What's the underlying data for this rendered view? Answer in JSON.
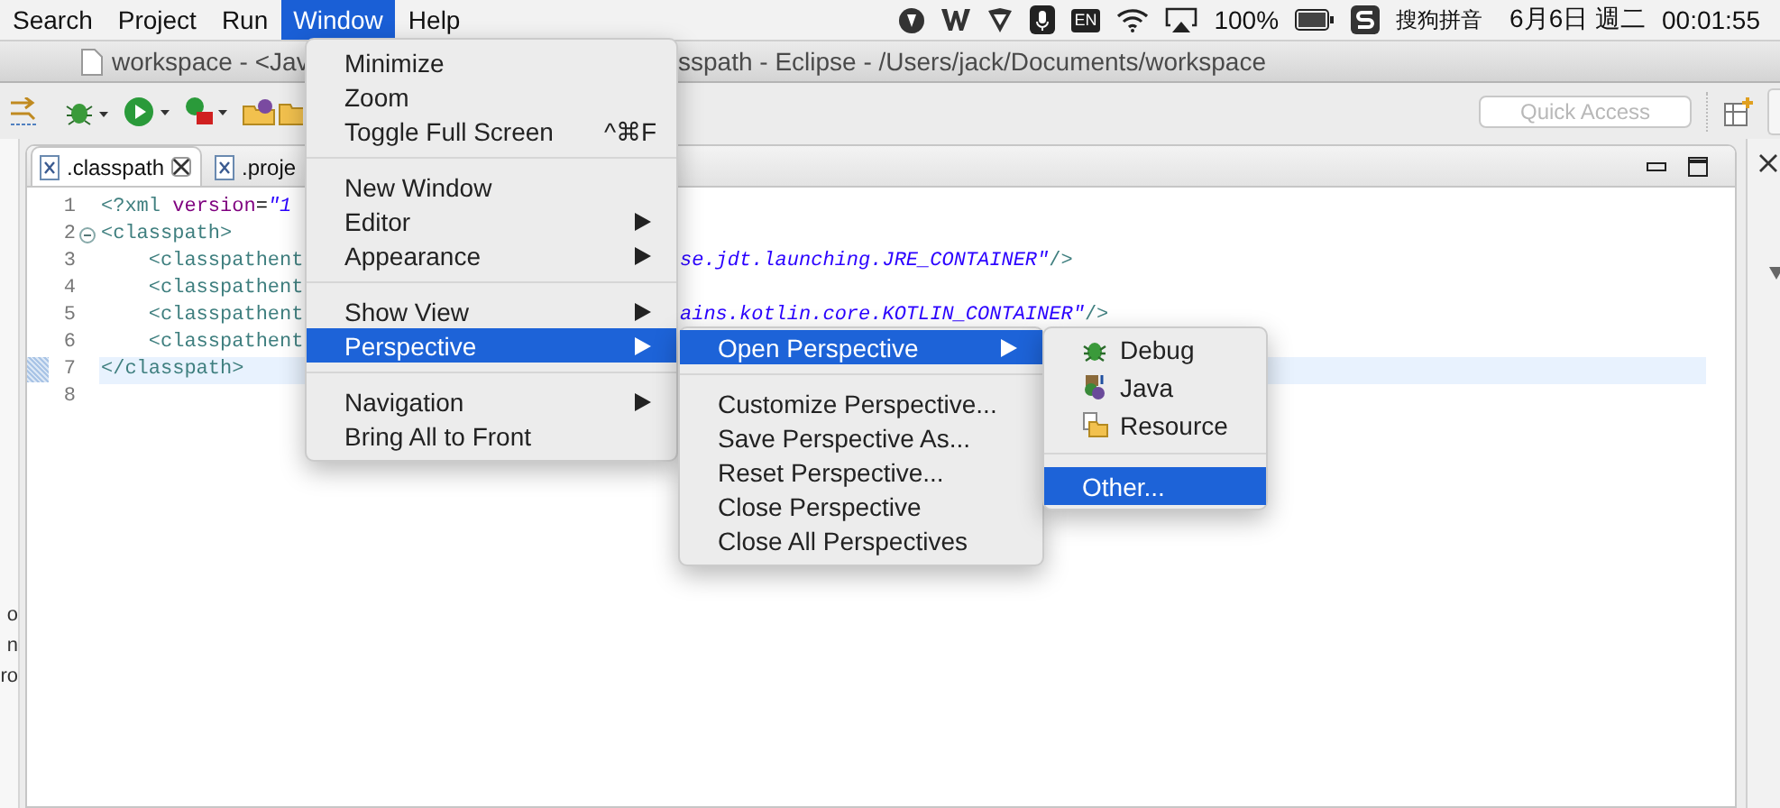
{
  "menubar": {
    "items": [
      {
        "label": "Search",
        "selected": false
      },
      {
        "label": "Project",
        "selected": false
      },
      {
        "label": "Run",
        "selected": false
      },
      {
        "label": "Window",
        "selected": true
      },
      {
        "label": "Help",
        "selected": false
      }
    ],
    "status": {
      "keyboard": "EN",
      "battery": "100%",
      "input_method": "搜狗拼音",
      "date": "6月6日 週二",
      "time": "00:01:55"
    }
  },
  "window": {
    "title_left": "workspace - <Jav",
    "title_right": "sspath - Eclipse - /Users/jack/Documents/workspace"
  },
  "toolbar": {
    "quick_access": {
      "placeholder": "Quick Access"
    }
  },
  "left_panel_fragments": [
    "o",
    "n",
    "ro"
  ],
  "editor": {
    "tabs": [
      {
        "label": ".classpath",
        "selected": true,
        "closable": true
      },
      {
        "label": ".proje",
        "selected": false,
        "closable": false
      }
    ],
    "lines": [
      {
        "number": "1",
        "current": false,
        "foldable": false,
        "tokens": [
          {
            "kind": "tag",
            "text": "<?xml"
          },
          {
            "kind": "attr",
            "text": " version"
          },
          {
            "kind": "plain",
            "text": "="
          },
          {
            "kind": "value",
            "text": "\"1"
          }
        ]
      },
      {
        "number": "2",
        "current": false,
        "foldable": true,
        "tokens": [
          {
            "kind": "tag",
            "text": "<classpath>"
          }
        ]
      },
      {
        "number": "3",
        "current": false,
        "foldable": false,
        "tokens": [
          {
            "kind": "tag",
            "text": "    <classpathent"
          }
        ],
        "tail": [
          {
            "kind": "value",
            "text": "se.jdt.launching.JRE_CONTAINER\""
          },
          {
            "kind": "tag",
            "text": "/>"
          }
        ]
      },
      {
        "number": "4",
        "current": false,
        "foldable": false,
        "tokens": [
          {
            "kind": "tag",
            "text": "    <classpathent"
          }
        ]
      },
      {
        "number": "5",
        "current": false,
        "foldable": false,
        "tokens": [
          {
            "kind": "tag",
            "text": "    <classpathent"
          }
        ],
        "tail": [
          {
            "kind": "value",
            "text": "ains.kotlin.core.KOTLIN_CONTAINER\""
          },
          {
            "kind": "tag",
            "text": "/>"
          }
        ]
      },
      {
        "number": "6",
        "current": false,
        "foldable": false,
        "tokens": [
          {
            "kind": "tag",
            "text": "    <classpathent"
          }
        ]
      },
      {
        "number": "7",
        "current": true,
        "foldable": false,
        "tokens": [
          {
            "kind": "tag",
            "text": "</classpath>"
          }
        ]
      },
      {
        "number": "8",
        "current": false,
        "foldable": false
      }
    ]
  },
  "window_menu": {
    "items": [
      {
        "kind": "item",
        "label": "Minimize",
        "submenu": false,
        "selected": false
      },
      {
        "kind": "item",
        "label": "Zoom",
        "submenu": false,
        "selected": false
      },
      {
        "kind": "item",
        "label": "Toggle Full Screen",
        "shortcut": "^⌘F",
        "submenu": false,
        "selected": false
      },
      {
        "kind": "separator"
      },
      {
        "kind": "item",
        "label": "New Window",
        "submenu": false,
        "selected": false
      },
      {
        "kind": "item",
        "label": "Editor",
        "submenu": true,
        "selected": false
      },
      {
        "kind": "item",
        "label": "Appearance",
        "submenu": true,
        "selected": false
      },
      {
        "kind": "separator"
      },
      {
        "kind": "item",
        "label": "Show View",
        "submenu": true,
        "selected": false
      },
      {
        "kind": "item",
        "label": "Perspective",
        "submenu": true,
        "selected": true
      },
      {
        "kind": "separator"
      },
      {
        "kind": "item",
        "label": "Navigation",
        "submenu": true,
        "selected": false
      },
      {
        "kind": "item",
        "label": "Bring All to Front",
        "submenu": false,
        "selected": false
      }
    ]
  },
  "perspective_menu": {
    "items": [
      {
        "kind": "item",
        "label": "Open Perspective",
        "submenu": true,
        "selected": true
      },
      {
        "kind": "separator"
      },
      {
        "kind": "item",
        "label": "Customize Perspective...",
        "submenu": false,
        "selected": false
      },
      {
        "kind": "item",
        "label": "Save Perspective As...",
        "submenu": false,
        "selected": false
      },
      {
        "kind": "item",
        "label": "Reset Perspective...",
        "submenu": false,
        "selected": false
      },
      {
        "kind": "item",
        "label": "Close Perspective",
        "submenu": false,
        "selected": false
      },
      {
        "kind": "item",
        "label": "Close All Perspectives",
        "submenu": false,
        "selected": false
      }
    ]
  },
  "open_perspective_menu": {
    "items": [
      {
        "kind": "item",
        "label": "Debug",
        "submenu": false,
        "selected": false
      },
      {
        "kind": "item",
        "label": "Java",
        "submenu": false,
        "selected": false
      },
      {
        "kind": "item",
        "label": "Resource",
        "submenu": false,
        "selected": false
      },
      {
        "kind": "separator"
      },
      {
        "kind": "item",
        "label": "Other...",
        "submenu": false,
        "selected": true
      }
    ]
  }
}
